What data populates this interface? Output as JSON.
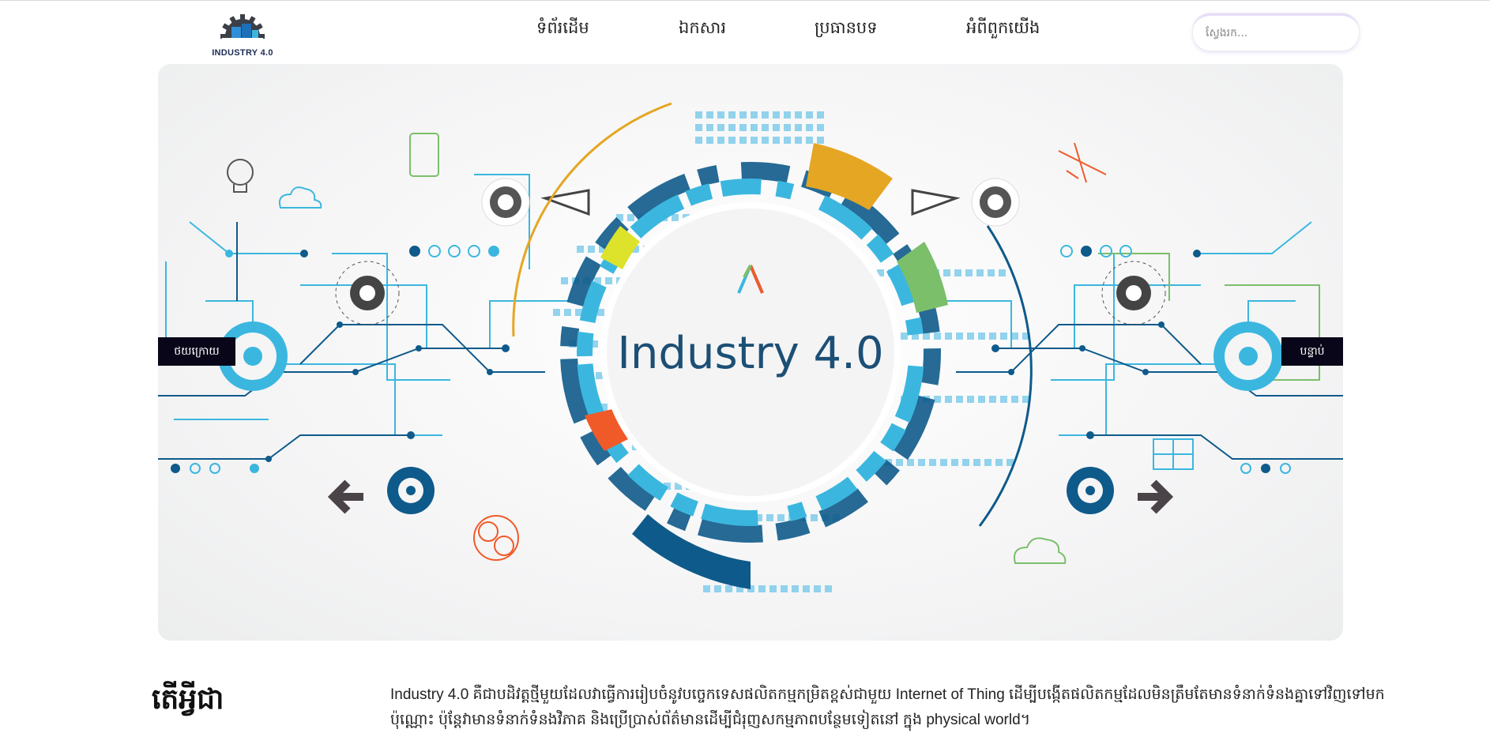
{
  "header": {
    "logo_text": "INDUSTRY 4.0",
    "nav": [
      {
        "label": "ទំព័រដើម"
      },
      {
        "label": "ឯកសារ"
      },
      {
        "label": "ប្រធានបទ"
      },
      {
        "label": "អំពីពួកយើង"
      }
    ],
    "search": {
      "placeholder": "ស្វែងរក...",
      "value": ""
    }
  },
  "banner": {
    "title": "Industry 4.0",
    "prev_label": "ថយក្រោយ",
    "next_label": "បន្ទាប់"
  },
  "content": {
    "heading": "តើអ្វីជា",
    "body": "Industry 4.0 គឺជាបដិវត្តថ្មីមួយដែលវាធ្វើការរៀបចំនូវបច្ចេកទេសផលិតកម្មកម្រិតខ្ពស់ជាមួយ Internet of Thing ដើម្បីបង្កើតផលិតកម្មដែលមិនត្រឹមតែមានទំនាក់ទំនងគ្នាទៅវិញទៅមកប៉ុណ្ណោះ ប៉ុន្តែវាមានទំនាក់ទំនងវិភាគ និងប្រើប្រាស់ព័ត៌មានដើម្បីជំរុញសកម្មភាពបន្ថែមទៀតនៅ ក្នុង physical world។"
  },
  "colors": {
    "navy": "#0e5a8a",
    "cyan": "#3bb7df",
    "orange": "#e5a623",
    "red_orange": "#f05a28",
    "lime": "#dde22a",
    "green": "#7bbf6a",
    "dark": "#080618"
  }
}
